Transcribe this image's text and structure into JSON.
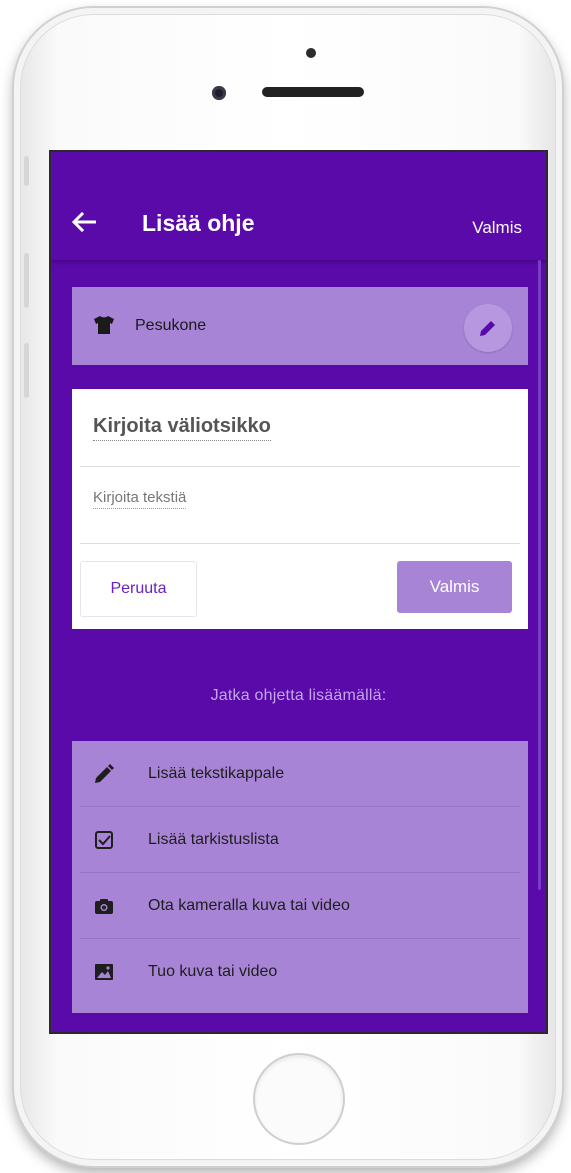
{
  "header": {
    "title": "Lisää ohje",
    "done_label": "Valmis"
  },
  "device": {
    "name": "Pesukone"
  },
  "editor": {
    "subtitle_placeholder": "Kirjoita väliotsikko",
    "text_placeholder": "Kirjoita tekstiä",
    "cancel_label": "Peruuta",
    "done_label": "Valmis"
  },
  "continue_label": "Jatka ohjetta lisäämällä:",
  "options": [
    {
      "label": "Lisää tekstikappale",
      "icon": "pencil-icon"
    },
    {
      "label": "Lisää tarkistuslista",
      "icon": "checkbox-icon"
    },
    {
      "label": "Ota kameralla kuva tai video",
      "icon": "camera-icon"
    },
    {
      "label": "Tuo kuva tai video",
      "icon": "image-icon"
    }
  ],
  "colors": {
    "primary": "#5a0aa9",
    "card_light": "#a884d6",
    "accent_text": "#6a22c2"
  }
}
